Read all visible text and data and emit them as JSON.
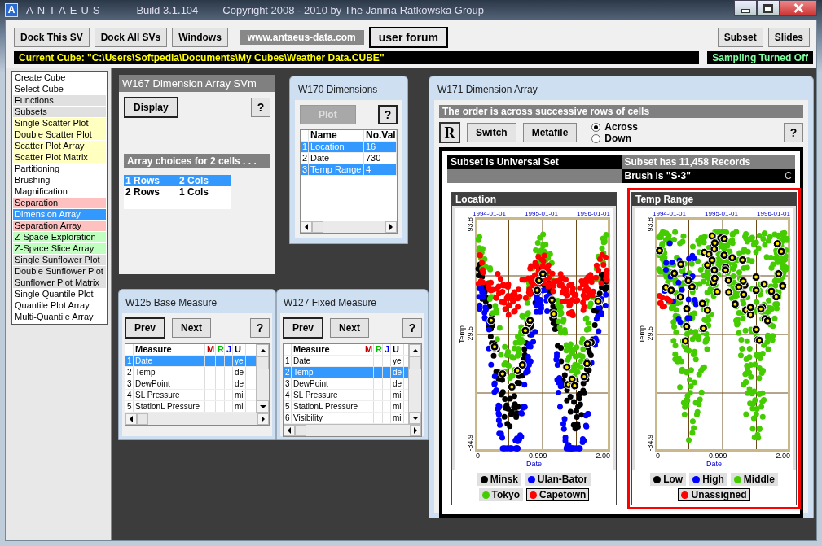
{
  "window": {
    "logo": "A",
    "app_name": "ANTAEUS",
    "build": "Build 3.1.104",
    "copyright": "Copyright 2008 - 2010 by The Janina Ratkowska Group"
  },
  "toolbar": {
    "buttons": [
      "Dock This SV",
      "Dock All SVs",
      "Windows"
    ],
    "link": "www.antaeus-data.com",
    "forum": "user forum",
    "right_buttons": [
      "Subset",
      "Slides"
    ]
  },
  "status": {
    "current_cube": "Current Cube: \"C:\\Users\\Softpedia\\Documents\\My Cubes\\Weather Data.CUBE\"",
    "sampling": "Sampling Turned Off"
  },
  "sidebar": {
    "items": [
      {
        "label": "Create Cube",
        "color": "#ffffff",
        "selected": false
      },
      {
        "label": "Select Cube",
        "color": "#ffffff",
        "selected": false
      },
      {
        "label": "Functions",
        "color": "#e0e0e0",
        "selected": false
      },
      {
        "label": "Subsets",
        "color": "#e0e0e0",
        "selected": false
      },
      {
        "label": "Single Scatter Plot",
        "color": "#ffffc0",
        "selected": false
      },
      {
        "label": "Double Scatter Plot",
        "color": "#ffffc0",
        "selected": false
      },
      {
        "label": "Scatter Plot Array",
        "color": "#ffffc0",
        "selected": false
      },
      {
        "label": "Scatter Plot Matrix",
        "color": "#ffffc0",
        "selected": false
      },
      {
        "label": "Partitioning",
        "color": "#ffffff",
        "selected": false
      },
      {
        "label": "Brushing",
        "color": "#ffffff",
        "selected": false
      },
      {
        "label": "Magnification",
        "color": "#ffffff",
        "selected": false
      },
      {
        "label": "Separation",
        "color": "#ffc0c0",
        "selected": false
      },
      {
        "label": "Dimension Array",
        "selected": true
      },
      {
        "label": "Separation Array",
        "color": "#ffc0c0",
        "selected": false
      },
      {
        "label": "Z-Space Exploration",
        "color": "#c0ffc0",
        "selected": false
      },
      {
        "label": "Z-Space Slice Array",
        "color": "#c0ffc0",
        "selected": false
      },
      {
        "label": "Single Sunflower Plot",
        "color": "#e0e0e0",
        "selected": false
      },
      {
        "label": "Double Sunflower Plot",
        "color": "#e0e0e0",
        "selected": false
      },
      {
        "label": "Sunflower Plot Matrix",
        "color": "#e0e0e0",
        "selected": false
      },
      {
        "label": "Single Quantile Plot",
        "color": "#ffffff",
        "selected": false
      },
      {
        "label": "Quantile Plot Array",
        "color": "#ffffff",
        "selected": false
      },
      {
        "label": "Multi-Quantile Array",
        "color": "#ffffff",
        "selected": false
      }
    ]
  },
  "w167": {
    "title": "W167 Dimension Array SVm",
    "button": "Display",
    "help": "?",
    "heading": "Array choices for 2 cells . . .",
    "choices": [
      {
        "rows": "1 Rows",
        "cols": "2 Cols",
        "selected": true
      },
      {
        "rows": "2 Rows",
        "cols": "1 Cols",
        "selected": false
      }
    ]
  },
  "w170": {
    "title": "W170  Dimensions",
    "button": {
      "label": "Plot",
      "disabled": true
    },
    "help": "?",
    "columns": [
      "Name",
      "No.Val"
    ],
    "rows": [
      {
        "num": "1",
        "name": "Location",
        "value": "16",
        "selected": true
      },
      {
        "num": "2",
        "name": "Date",
        "value": "730",
        "selected": false
      },
      {
        "num": "3",
        "name": "Temp Range",
        "value": "4",
        "selected": true
      }
    ]
  },
  "measures": [
    {
      "title": "W125  Base Measure",
      "prev": "Prev",
      "next": "Next",
      "help": "?",
      "columns": [
        {
          "label": "Measure",
          "color": "#000000"
        },
        {
          "label": "M",
          "color": "#c00000"
        },
        {
          "label": "R",
          "color": "#00c000"
        },
        {
          "label": "J",
          "color": "#0000ff"
        },
        {
          "label": "U",
          "color": "#000000"
        }
      ],
      "rows": [
        {
          "num": "1",
          "measure": "Date",
          "unit": "ye",
          "selected": true
        },
        {
          "num": "2",
          "measure": "Temp",
          "unit": "de",
          "selected": false
        },
        {
          "num": "3",
          "measure": "DewPoint",
          "unit": "de",
          "selected": false
        },
        {
          "num": "4",
          "measure": "SL Pressure",
          "unit": "mi",
          "selected": false
        },
        {
          "num": "5",
          "measure": "StationL Pressure",
          "unit": "mi",
          "selected": false
        }
      ]
    },
    {
      "title": "W127  Fixed Measure",
      "prev": "Prev",
      "next": "Next",
      "help": "?",
      "columns": [
        {
          "label": "Measure",
          "color": "#000000"
        },
        {
          "label": "M",
          "color": "#c00000"
        },
        {
          "label": "R",
          "color": "#00c000"
        },
        {
          "label": "J",
          "color": "#0000ff"
        },
        {
          "label": "U",
          "color": "#000000"
        }
      ],
      "rows": [
        {
          "num": "1",
          "measure": "Date",
          "unit": "ye",
          "selected": false
        },
        {
          "num": "2",
          "measure": "Temp",
          "unit": "de",
          "selected": true
        },
        {
          "num": "3",
          "measure": "DewPoint",
          "unit": "de",
          "selected": false
        },
        {
          "num": "4",
          "measure": "SL Pressure",
          "unit": "mi",
          "selected": false
        },
        {
          "num": "5",
          "measure": "StationL Pressure",
          "unit": "mi",
          "selected": false
        },
        {
          "num": "6",
          "measure": "Visibility",
          "unit": "mi",
          "selected": false
        }
      ]
    }
  ],
  "w171": {
    "title": "W171  Dimension Array",
    "banner": "The order is across successive rows of cells",
    "r_button": "R",
    "buttons": [
      "Switch",
      "Metafile"
    ],
    "radios": [
      {
        "label": "Across",
        "selected": true
      },
      {
        "label": "Down",
        "selected": false
      }
    ],
    "help": "?",
    "subset": "Subset is Universal Set",
    "records": "Subset has 11,458 Records",
    "brush": "Brush is \"S-3\"",
    "brush_tag": "C",
    "panels": [
      {
        "title": "Location",
        "selected": false,
        "top_ticks": [
          "1994-01-01",
          "1995-01-01",
          "1996-01-01"
        ],
        "y_ticks": [
          "93.8",
          "29.5",
          "-34.9"
        ],
        "ylabel": "Temp",
        "x_ticks": [
          "0",
          "0.999",
          "2.00"
        ],
        "xlabel": "Date",
        "legend": [
          {
            "label": "Minsk",
            "color": "#000000",
            "selected": false
          },
          {
            "label": "Ulan-Bator",
            "color": "#0000ff",
            "selected": false
          },
          {
            "label": "Tokyo",
            "color": "#44cc00",
            "selected": false
          },
          {
            "label": "Capetown",
            "color": "#ff0000",
            "selected": true
          }
        ]
      },
      {
        "title": "Temp Range",
        "selected": true,
        "top_ticks": [
          "1994-01-01",
          "1995-01-01",
          "1996-01-01"
        ],
        "y_ticks": [
          "93.8",
          "29.5",
          "-34.9"
        ],
        "ylabel": "Temp",
        "x_ticks": [
          "0",
          "0.999",
          "2.00"
        ],
        "xlabel": "Date",
        "legend": [
          {
            "label": "Low",
            "color": "#000000",
            "selected": false
          },
          {
            "label": "High",
            "color": "#0000ff",
            "selected": false
          },
          {
            "label": "Middle",
            "color": "#44cc00",
            "selected": false
          },
          {
            "label": "Unassigned",
            "color": "#ff0000",
            "selected": true
          }
        ]
      }
    ]
  }
}
